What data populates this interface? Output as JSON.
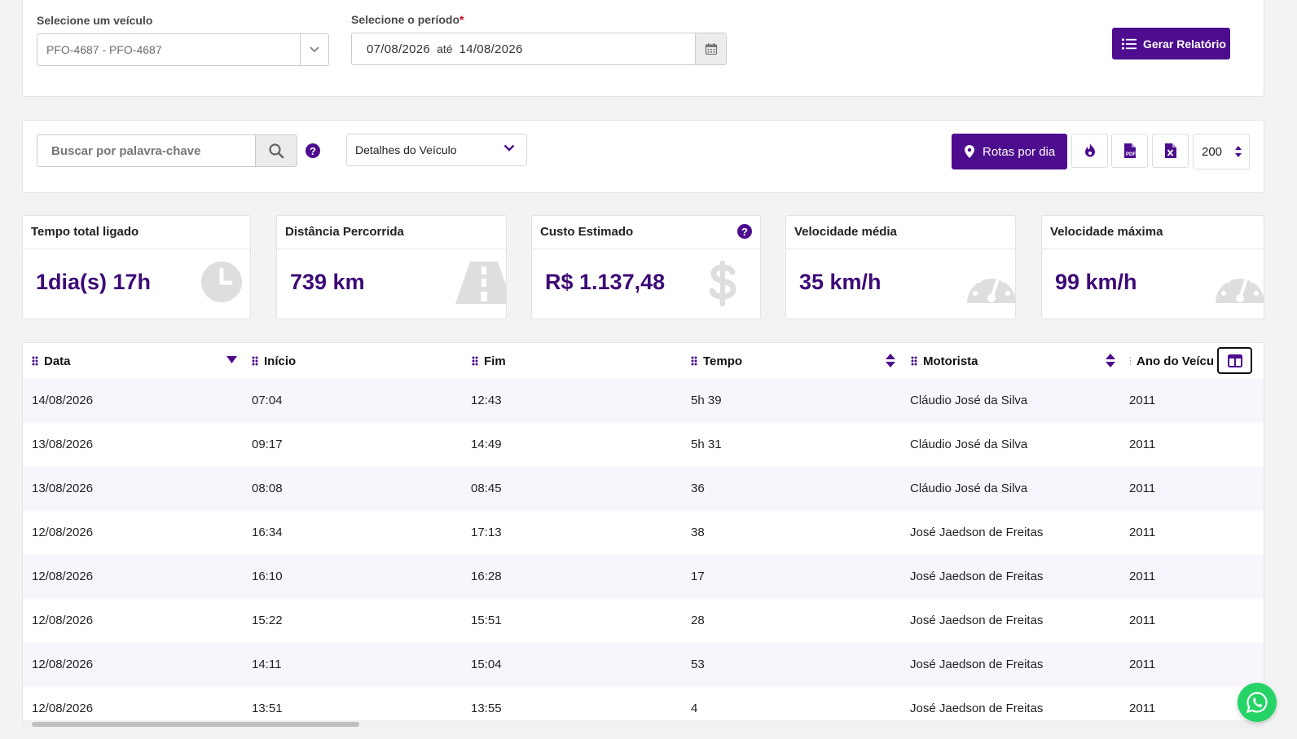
{
  "filters": {
    "vehicle_label": "Selecione um veículo",
    "vehicle_value": "PFO-4687 - PFO-4687",
    "period_label": "Selecione o período",
    "required_mark": "*",
    "date_from": "07/08/2026",
    "date_sep": "até",
    "date_to": "14/08/2026",
    "generate_button": "Gerar Relatório"
  },
  "toolbar": {
    "search_placeholder": "Buscar por palavra-chave",
    "help": "?",
    "view_select": "Detalhes do Veículo",
    "routes_button": "Rotas por dia",
    "page_size": "200"
  },
  "stats": [
    {
      "title": "Tempo total ligado",
      "value": "1dia(s) 17h",
      "icon": "clock-icon"
    },
    {
      "title": "Distância Percorrida",
      "value": "739 km",
      "icon": "road-icon"
    },
    {
      "title": "Custo Estimado",
      "value": "R$ 1.137,48",
      "icon": "dollar-icon"
    },
    {
      "title": "Velocidade média",
      "value": "35 km/h",
      "icon": "speedometer-icon"
    },
    {
      "title": "Velocidade máxima",
      "value": "99 km/h",
      "icon": "speedometer-icon"
    }
  ],
  "table": {
    "headers": [
      "Data",
      "Início",
      "Fim",
      "Tempo",
      "Motorista",
      "Ano do Veícu"
    ],
    "rows": [
      [
        "14/08/2026",
        "07:04",
        "12:43",
        "5h 39",
        "Cláudio José da Silva",
        "2011"
      ],
      [
        "13/08/2026",
        "09:17",
        "14:49",
        "5h 31",
        "Cláudio José da Silva",
        "2011"
      ],
      [
        "13/08/2026",
        "08:08",
        "08:45",
        "36",
        "Cláudio José da Silva",
        "2011"
      ],
      [
        "12/08/2026",
        "16:34",
        "17:13",
        "38",
        "José Jaedson de Freitas",
        "2011"
      ],
      [
        "12/08/2026",
        "16:10",
        "16:28",
        "17",
        "José Jaedson de Freitas",
        "2011"
      ],
      [
        "12/08/2026",
        "15:22",
        "15:51",
        "28",
        "José Jaedson de Freitas",
        "2011"
      ],
      [
        "12/08/2026",
        "14:11",
        "15:04",
        "53",
        "José Jaedson de Freitas",
        "2011"
      ],
      [
        "12/08/2026",
        "13:51",
        "13:55",
        "4",
        "José Jaedson de Freitas",
        "2011"
      ]
    ]
  },
  "colors": {
    "primary": "#4d0d8e",
    "value_text": "#3d0a77",
    "stripe": "#f8f5fc",
    "whatsapp": "#25d366"
  }
}
